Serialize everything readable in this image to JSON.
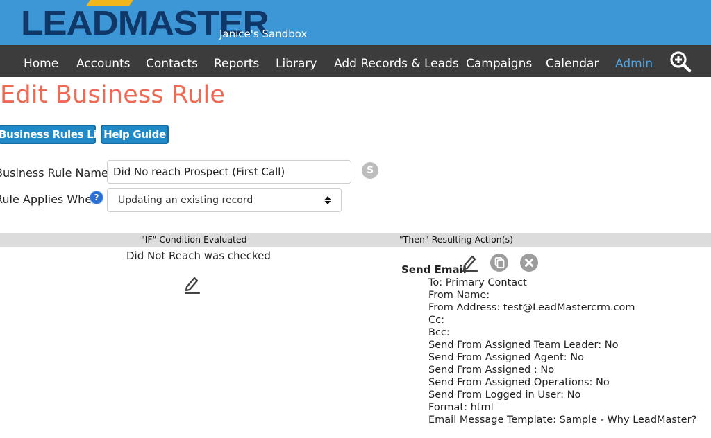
{
  "header": {
    "logo_text": "LEADMASTER",
    "sandbox_label": "Janice's Sandbox"
  },
  "nav": {
    "items": [
      {
        "label": "Home"
      },
      {
        "label": "Accounts"
      },
      {
        "label": "Contacts"
      },
      {
        "label": "Reports"
      },
      {
        "label": "Library"
      },
      {
        "label": "Add Records & Leads"
      },
      {
        "label": "Campaigns"
      },
      {
        "label": "Calendar"
      },
      {
        "label": "Admin",
        "active": true
      }
    ],
    "zoom_icon": "zoom-in-icon"
  },
  "page": {
    "title": "Edit Business Rule"
  },
  "buttons": {
    "rules_list": "Business Rules List",
    "help_guide": "Help Guide"
  },
  "form": {
    "name_label": "Business Rule Name:",
    "name_value": "Did No reach Prospect (First Call)",
    "s_badge": "S",
    "applies_label": "Rule Applies When",
    "help_glyph": "?",
    "applies_value": "Updating an existing record"
  },
  "table": {
    "if_header": "\"IF\" Condition Evaluated",
    "then_header": "\"Then\" Resulting Action(s)",
    "condition": "Did Not Reach was checked"
  },
  "action": {
    "title": "Send Email",
    "details": [
      "To: Primary Contact",
      "From Name:",
      "From Address: test@LeadMastercrm.com",
      "Cc:",
      "Bcc:",
      "Send From Assigned Team Leader: No",
      "Send From Assigned Agent: No",
      "Send From Assigned : No",
      "Send From Assigned Operations: No",
      "Send From Logged in User: No",
      "Format: html",
      "Email Message Template: Sample - Why LeadMaster?"
    ]
  },
  "colors": {
    "banner": "#3d97d6",
    "navbar": "#3c3c3c",
    "title": "#ef6a53",
    "button": "#2189c6",
    "active_nav": "#4aa6e8"
  }
}
